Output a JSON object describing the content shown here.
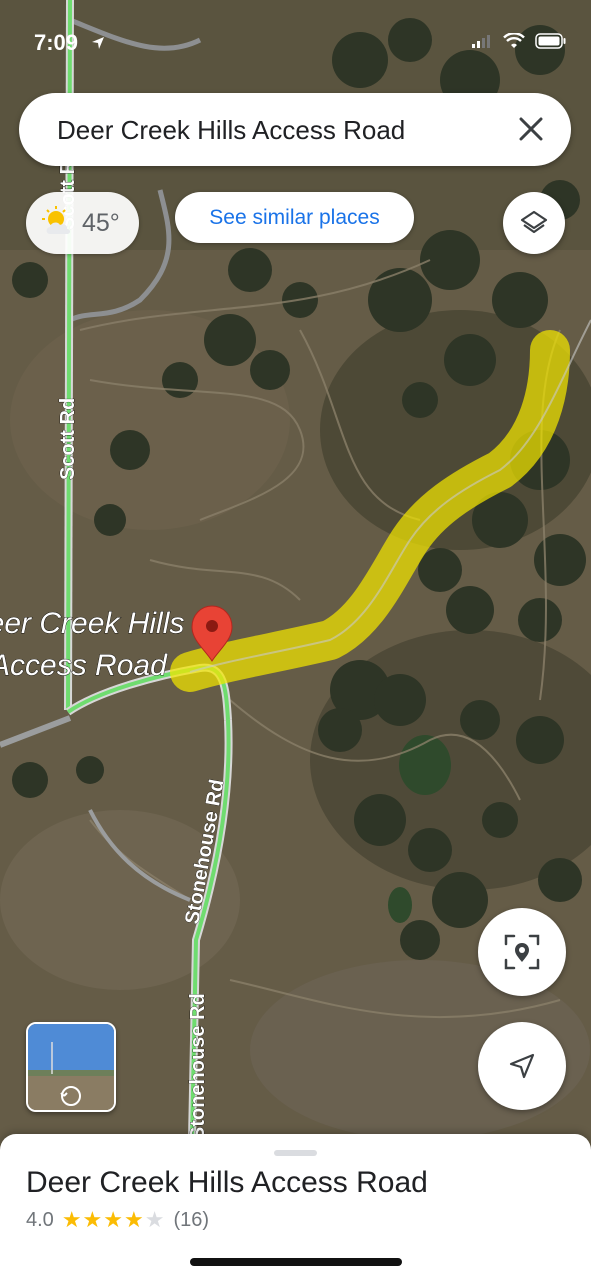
{
  "status_bar": {
    "time": "7:09"
  },
  "search": {
    "query": "Deer Creek Hills Access Road"
  },
  "weather": {
    "temperature": "45°",
    "icon": "partly-cloudy-icon"
  },
  "chips": {
    "similar_label": "See similar places"
  },
  "map": {
    "place_label_line1": "Deer Creek Hills",
    "place_label_line2": "Access Road",
    "roads": {
      "scott_rd": "Scott Rd",
      "scott_rd_top": "Scott Rd",
      "stonehouse_rd": "Stonehouse Rd",
      "stonehouse_rd_lower": "Stonehouse Rd"
    },
    "colors": {
      "highlight": "#f2e600",
      "road_green": "#6fdc6f",
      "pin": "#e84335"
    }
  },
  "sheet": {
    "title": "Deer Creek Hills Access Road",
    "rating": "4.0",
    "stars_filled": 4,
    "reviews": "(16)"
  }
}
